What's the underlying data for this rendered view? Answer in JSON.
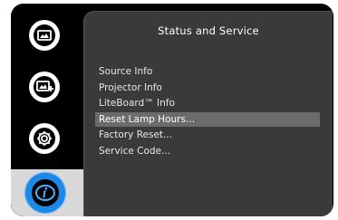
{
  "sidebar": {
    "items": [
      {
        "icon": "display-image-icon"
      },
      {
        "icon": "display-add-icon"
      },
      {
        "icon": "gear-icon"
      },
      {
        "icon": "info-icon",
        "active": true
      }
    ]
  },
  "panel": {
    "title": "Status and Service",
    "items": [
      {
        "label": "Source Info"
      },
      {
        "label": "Projector Info"
      },
      {
        "label": "LiteBoard™ Info"
      },
      {
        "label": "Reset Lamp Hours...",
        "selected": true
      },
      {
        "label": "Factory Reset..."
      },
      {
        "label": "Service Code..."
      }
    ]
  },
  "colors": {
    "background": "#000000",
    "panel": "#3a3a3a",
    "selected_row": "#6b6b6b",
    "active_icon": "#1e88e5",
    "text": "#ffffff"
  }
}
